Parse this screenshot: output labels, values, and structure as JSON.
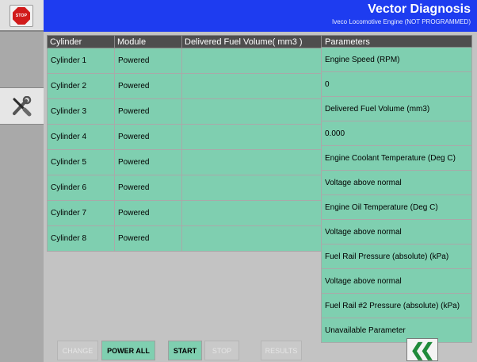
{
  "header": {
    "title": "Vector Diagnosis",
    "subtitle": "Iveco Locomotive Engine (NOT PROGRAMMED)"
  },
  "sidebar": {
    "stop_label": "STOP",
    "stop_icon": "stop-sign-icon",
    "tools_icon": "tools-icon"
  },
  "table": {
    "headers": [
      "Cylinder",
      "Module",
      "Delivered Fuel Volume( mm3 )"
    ],
    "rows": [
      {
        "cylinder": "Cylinder 1",
        "module": "Powered",
        "fuel": ""
      },
      {
        "cylinder": "Cylinder 2",
        "module": "Powered",
        "fuel": ""
      },
      {
        "cylinder": "Cylinder 3",
        "module": "Powered",
        "fuel": ""
      },
      {
        "cylinder": "Cylinder 4",
        "module": "Powered",
        "fuel": ""
      },
      {
        "cylinder": "Cylinder 5",
        "module": "Powered",
        "fuel": ""
      },
      {
        "cylinder": "Cylinder 6",
        "module": "Powered",
        "fuel": ""
      },
      {
        "cylinder": "Cylinder 7",
        "module": "Powered",
        "fuel": ""
      },
      {
        "cylinder": "Cylinder 8",
        "module": "Powered",
        "fuel": ""
      }
    ]
  },
  "parameters": {
    "header": "Parameters",
    "items": [
      "Engine Speed (RPM)",
      "0",
      "Delivered Fuel Volume (mm3)",
      "0.000",
      "Engine Coolant Temperature (Deg C)",
      "Voltage above normal",
      "Engine Oil Temperature (Deg C)",
      "Voltage above normal",
      "Fuel Rail Pressure (absolute) (kPa)",
      "Voltage above normal",
      "Fuel Rail #2 Pressure (absolute) (kPa)",
      "Unavailable Parameter"
    ]
  },
  "buttons": {
    "change": "CHANGE",
    "power_all": "POWER ALL",
    "start": "START",
    "stop": "STOP",
    "results": "RESULTS",
    "back_icon": "double-chevron-left-icon"
  },
  "colors": {
    "header_bg": "#1e3cf0",
    "cell_bg": "#7fcfb0",
    "header_cell_bg": "#4e4e4e",
    "back_arrow": "#1f8a3a",
    "stop_red": "#d11a1a"
  }
}
